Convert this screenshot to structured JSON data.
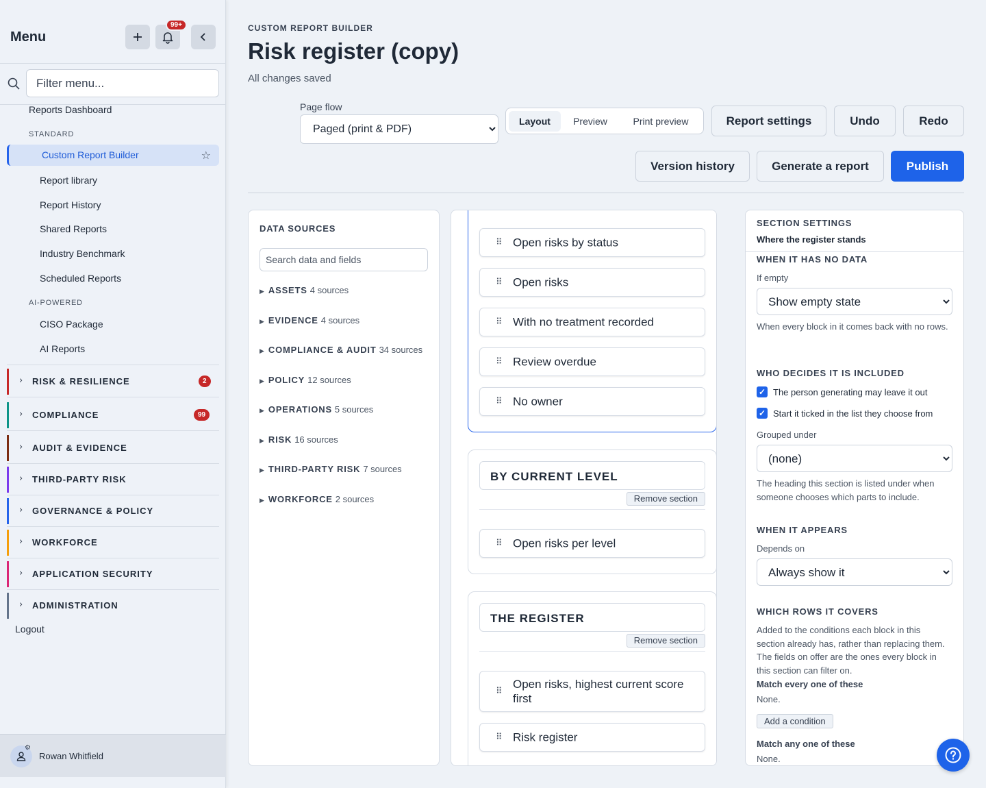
{
  "sidebar": {
    "title": "Menu",
    "notification_count": "99+",
    "filter_placeholder": "Filter menu...",
    "top_link": "Reports Dashboard",
    "section_standard": "STANDARD",
    "active_item": "Custom Report Builder",
    "standard_items": [
      "Report library",
      "Report History",
      "Shared Reports",
      "Industry Benchmark",
      "Scheduled Reports"
    ],
    "section_ai": "AI-POWERED",
    "ai_items": [
      "CISO Package",
      "AI Reports"
    ],
    "groups": [
      {
        "label": "RISK & RESILIENCE",
        "count": "2",
        "color": "#c62828"
      },
      {
        "label": "COMPLIANCE",
        "count": "99",
        "color": "#0d9488"
      },
      {
        "label": "AUDIT & EVIDENCE",
        "count": "",
        "color": "#7c2d12"
      },
      {
        "label": "THIRD-PARTY RISK",
        "count": "",
        "color": "#7c3aed"
      },
      {
        "label": "GOVERNANCE & POLICY",
        "count": "",
        "color": "#2563eb"
      },
      {
        "label": "WORKFORCE",
        "count": "",
        "color": "#f59e0b"
      },
      {
        "label": "APPLICATION SECURITY",
        "count": "",
        "color": "#db2777"
      },
      {
        "label": "ADMINISTRATION",
        "count": "",
        "color": "#64748b"
      }
    ],
    "logout": "Logout",
    "user_name": "Rowan Whitfield"
  },
  "header": {
    "eyebrow": "CUSTOM REPORT BUILDER",
    "title": "Risk register (copy)",
    "status": "All changes saved",
    "page_flow_label": "Page flow",
    "page_flow_value": "Paged (print & PDF)",
    "view_tabs": [
      "Layout",
      "Preview",
      "Print preview"
    ],
    "active_tab": "Layout",
    "report_settings": "Report settings",
    "undo": "Undo",
    "redo": "Redo",
    "version_history": "Version history",
    "generate": "Generate a report",
    "publish": "Publish",
    "accent": "#1e63e9"
  },
  "data_sources": {
    "title": "DATA SOURCES",
    "search_placeholder": "Search data and fields",
    "groups": [
      {
        "name": "ASSETS",
        "count": "4 sources"
      },
      {
        "name": "EVIDENCE",
        "count": "4 sources"
      },
      {
        "name": "COMPLIANCE & AUDIT",
        "count": "34 sources"
      },
      {
        "name": "POLICY",
        "count": "12 sources"
      },
      {
        "name": "OPERATIONS",
        "count": "5 sources"
      },
      {
        "name": "RISK",
        "count": "16 sources"
      },
      {
        "name": "THIRD-PARTY RISK",
        "count": "7 sources"
      },
      {
        "name": "WORKFORCE",
        "count": "2 sources"
      }
    ]
  },
  "canvas": {
    "section1_blocks": [
      "Open risks by status",
      "Open risks",
      "With no treatment recorded",
      "Review overdue",
      "No owner"
    ],
    "section2_title": "BY CURRENT LEVEL",
    "section2_blocks": [
      "Open risks per level"
    ],
    "section3_title": "THE REGISTER",
    "section3_blocks": [
      "Open risks, highest current score first",
      "Risk register"
    ],
    "remove_label": "Remove section"
  },
  "settings": {
    "caption": "SECTION SETTINGS",
    "section_name": "Where the register stands",
    "no_data_cap": "WHEN IT HAS NO DATA",
    "if_empty_label": "If empty",
    "if_empty_value": "Show empty state",
    "if_empty_help": "When every block in it comes back with no rows.",
    "included_cap": "WHO DECIDES IT IS INCLUDED",
    "check1": "The person generating may leave it out",
    "check2": "Start it ticked in the list they choose from",
    "grouped_label": "Grouped under",
    "grouped_value": "(none)",
    "grouped_help": "The heading this section is listed under when someone chooses which parts to include.",
    "appears_cap": "WHEN IT APPEARS",
    "depends_label": "Depends on",
    "depends_value": "Always show it",
    "rows_cap": "WHICH ROWS IT COVERS",
    "rows_help": "Added to the conditions each block in this section already has, rather than replacing them. The fields on offer are the ones every block in this section can filter on.",
    "match_all": "Match every one of these",
    "none1": "None.",
    "add_condition": "Add a condition",
    "match_any": "Match any one of these",
    "none2": "None."
  }
}
